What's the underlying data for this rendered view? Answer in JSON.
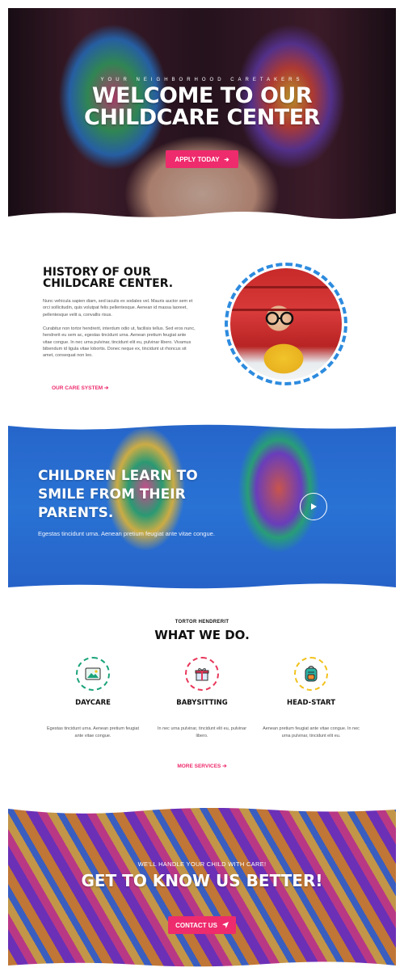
{
  "hero": {
    "kicker": "YOUR NEIGHBORHOOD CARETAKERS",
    "title_line1": "WELCOME TO OUR",
    "title_line2": "CHILDCARE CENTER",
    "button_label": "APPLY TODAY",
    "button_icon": "arrow-right-icon"
  },
  "history": {
    "title_line1": "HISTORY OF OUR",
    "title_line2": "CHILDCARE CENTER.",
    "paragraph1": "Nunc vehicula sapien diam, sed iaculis ex sodales vel. Mauris auctor sem et orci sollicitudin, quis volutpat felis pellentesque. Aenean id massa laoreet, pellentesque velit a, convallis risus.",
    "paragraph2": "Curabitur non tortor hendrerit, interdum odio ut, facilisis tellus. Sed eros nunc, hendrerit eu sem ac, egestas tincidunt urna. Aenean pretium feugiat ante vitae congue. In nec urna pulvinar, tincidunt elit eu, pulvinar libero. Vivamus bibendum id ligula vitae lobortis. Donec neque ex, tincidunt ut rhoncus sit amet, consequat non leo.",
    "link_label": "OUR CARE SYSTEM",
    "link_icon": "arrow-right-icon"
  },
  "video": {
    "title_line1": "CHILDREN LEARN TO",
    "title_line2": "SMILE FROM THEIR",
    "title_line3": "PARENTS.",
    "subtitle": "Egestas tincidunt urna. Aenean pretium feugiat ante vitae congue.",
    "play_icon": "play-icon"
  },
  "services": {
    "kicker": "TORTOR HENDRERIT",
    "title": "WHAT WE DO.",
    "items": [
      {
        "name": "DAYCARE",
        "description": "Egestas tincidunt urna. Aenean pretium feugiat ante vitae congue.",
        "icon": "picture-icon",
        "ring_color": "#1aa37a"
      },
      {
        "name": "BABYSITTING",
        "description": "In nec urna pulvinar, tincidunt elit eu, pulvinar libero.",
        "icon": "gift-icon",
        "ring_color": "#e8365a"
      },
      {
        "name": "HEAD-START",
        "description": "Aenean pretium feugiat ante vitae congue. In nec urna pulvinar, tincidunt elit eu.",
        "icon": "backpack-icon",
        "ring_color": "#f2c21b"
      }
    ],
    "more_label": "MORE SERVICES",
    "more_icon": "arrow-right-icon"
  },
  "cta": {
    "kicker": "WE'LL HANDLE YOUR CHILD WITH CARE!",
    "title": "GET TO KNOW US BETTER!",
    "button_label": "CONTACT US",
    "button_icon": "paper-plane-icon"
  },
  "colors": {
    "accent": "#ee2b6c",
    "hero_bg": "#2a1520",
    "video_bg": "#2e7fe0"
  }
}
